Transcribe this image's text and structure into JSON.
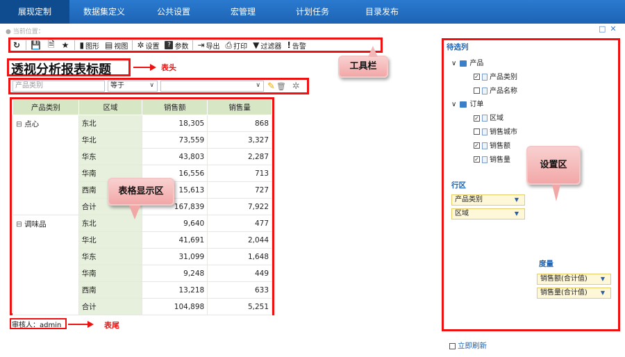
{
  "nav": {
    "tabs": [
      "展现定制",
      "数据集定义",
      "公共设置",
      "宏管理",
      "计划任务",
      "目录发布"
    ]
  },
  "location": "当前位置：",
  "toolbar": {
    "refresh": "",
    "save": "",
    "saveas": "",
    "favorite": "",
    "chart": "图形",
    "view": "视图",
    "settings": "设置",
    "params": "参数",
    "export": "导出",
    "print": "打印",
    "filter": "过滤器",
    "alert": "告警"
  },
  "report": {
    "title": "透视分析报表标题",
    "footer": "审核人：admin"
  },
  "annotations": {
    "header": "表头",
    "footer": "表尾",
    "toolbar": "工具栏",
    "grid": "表格显示区",
    "settings": "设置区"
  },
  "filter": {
    "field_placeholder": "产品类别",
    "operator": "等于",
    "value": ""
  },
  "table": {
    "headers": [
      "产品类别",
      "区域",
      "销售额",
      "销售量"
    ],
    "groups": [
      {
        "category": "点心",
        "rows": [
          {
            "region": "东北",
            "amount": "18,305",
            "qty": "868"
          },
          {
            "region": "华北",
            "amount": "73,559",
            "qty": "3,327"
          },
          {
            "region": "华东",
            "amount": "43,803",
            "qty": "2,287"
          },
          {
            "region": "华南",
            "amount": "16,556",
            "qty": "713"
          },
          {
            "region": "西南",
            "amount": "15,613",
            "qty": "727"
          },
          {
            "region": "合计",
            "amount": "167,839",
            "qty": "7,922"
          }
        ]
      },
      {
        "category": "调味品",
        "rows": [
          {
            "region": "东北",
            "amount": "9,640",
            "qty": "477"
          },
          {
            "region": "华北",
            "amount": "41,691",
            "qty": "2,044"
          },
          {
            "region": "华东",
            "amount": "31,099",
            "qty": "1,648"
          },
          {
            "region": "华南",
            "amount": "9,248",
            "qty": "449"
          },
          {
            "region": "西南",
            "amount": "13,218",
            "qty": "633"
          },
          {
            "region": "合计",
            "amount": "104,898",
            "qty": "5,251"
          }
        ]
      }
    ]
  },
  "panel": {
    "available_title": "待选列",
    "groups": [
      {
        "name": "产品",
        "fields": [
          {
            "name": "产品类别",
            "checked": true
          },
          {
            "name": "产品名称",
            "checked": false
          }
        ]
      },
      {
        "name": "订单",
        "fields": [
          {
            "name": "区域",
            "checked": true
          },
          {
            "name": "销售城市",
            "checked": false
          },
          {
            "name": "销售额",
            "checked": true
          },
          {
            "name": "销售量",
            "checked": true
          }
        ]
      }
    ],
    "row_title": "行区",
    "row_fields": [
      "产品类别",
      "区域"
    ],
    "measure_title": "度量",
    "measures": [
      "销售额(合计值)",
      "销售量(合计值)"
    ],
    "refresh_label": "立即刷新"
  },
  "colors": {
    "nav": "#1d63b3",
    "highlight": "#e11111",
    "header_cell": "#d7e6c4"
  }
}
